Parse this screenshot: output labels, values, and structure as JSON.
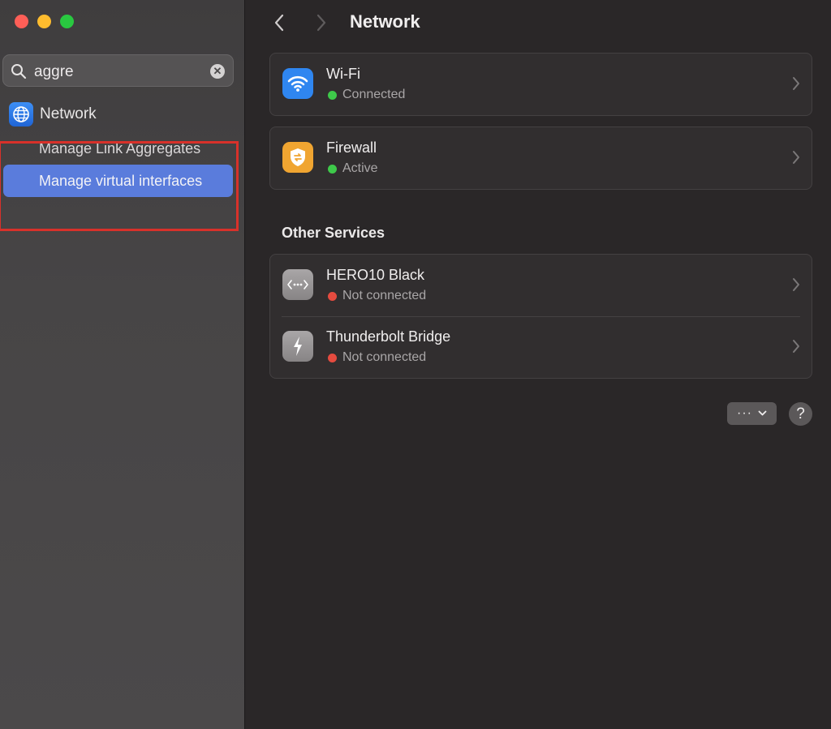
{
  "sidebar": {
    "search": {
      "query": "aggre"
    },
    "nav_network_label": "Network",
    "sub_items": [
      {
        "label": "Manage Link Aggregates",
        "selected": false
      },
      {
        "label": "Manage virtual interfaces",
        "selected": true
      }
    ]
  },
  "toolbar": {
    "title": "Network"
  },
  "services": [
    {
      "name": "Wi-Fi",
      "status": "Connected",
      "status_color": "#3ec94a",
      "icon": "wifi-icon",
      "icon_color": "#2f86f0"
    },
    {
      "name": "Firewall",
      "status": "Active",
      "status_color": "#3ec94a",
      "icon": "firewall-icon",
      "icon_color": "#f0a531"
    }
  ],
  "other_services_title": "Other Services",
  "other_services": [
    {
      "name": "HERO10 Black",
      "status": "Not connected",
      "status_color": "#e54b3f",
      "icon": "ethernet-dots-icon",
      "icon_color": "#9a9798"
    },
    {
      "name": "Thunderbolt Bridge",
      "status": "Not connected",
      "status_color": "#e54b3f",
      "icon": "thunderbolt-icon",
      "icon_color": "#9a9798"
    }
  ],
  "footer": {
    "more_label": "···",
    "help_label": "?"
  },
  "colors": {
    "accent": "#5a7cdc",
    "highlight_outline": "#d8312a"
  }
}
